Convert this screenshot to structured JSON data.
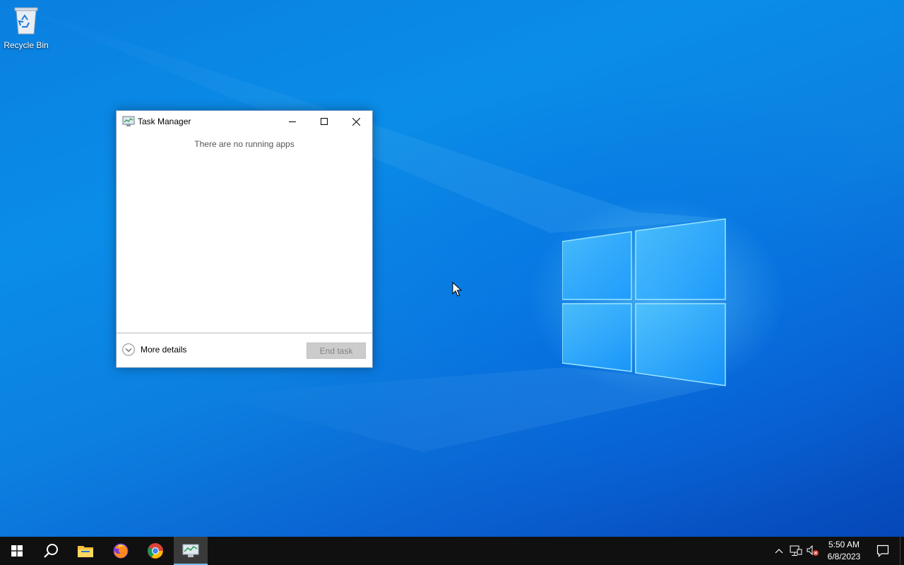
{
  "desktop": {
    "icons": [
      {
        "label": "Recycle Bin",
        "icon": "recycle-bin-icon"
      }
    ]
  },
  "window": {
    "title": "Task Manager",
    "icon": "task-manager-icon",
    "empty_message": "There are no running apps",
    "more_details_label": "More details",
    "end_task_label": "End task"
  },
  "taskbar": {
    "items": [
      {
        "name": "start",
        "icon": "windows-start-icon"
      },
      {
        "name": "search",
        "icon": "search-icon"
      },
      {
        "name": "file-explorer",
        "icon": "folder-icon"
      },
      {
        "name": "firefox",
        "icon": "firefox-icon"
      },
      {
        "name": "chrome",
        "icon": "chrome-icon"
      },
      {
        "name": "task-manager",
        "icon": "task-manager-icon",
        "active": true
      }
    ],
    "tray": {
      "time": "5:50 AM",
      "date": "6/8/2023"
    }
  },
  "colors": {
    "taskbar": "#101010",
    "active_indicator": "#76b9ed",
    "desktop_blue": "#0a8de8"
  }
}
